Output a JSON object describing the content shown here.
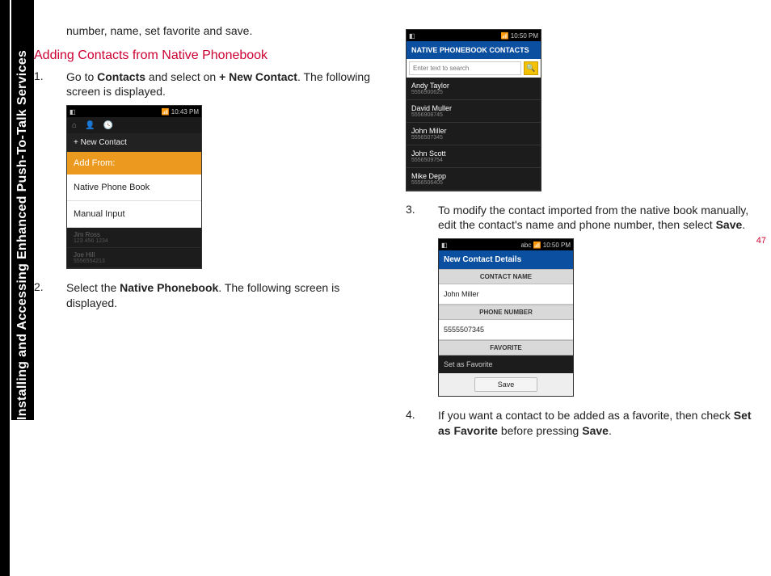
{
  "sidebar": {
    "label": "Installing and Accessing Enhanced Push-To-Talk Services"
  },
  "page_number": "47",
  "intro_line": "number, name, set favorite and save.",
  "section_title": "Adding Contacts from Native Phonebook",
  "steps": {
    "s1": {
      "num": "1.",
      "pre": "Go to ",
      "b1": "Contacts",
      "mid": " and select on ",
      "b2": "+ New Contact",
      "post": ". The following screen is displayed."
    },
    "s2": {
      "num": "2.",
      "pre": "Select the ",
      "b1": "Native Phonebook",
      "post": ". The following screen is displayed."
    },
    "s3": {
      "num": "3.",
      "text": "To modify the contact imported from the native book manually, edit the contact's name and phone number, then select ",
      "b1": "Save",
      "post": "."
    },
    "s4": {
      "num": "4.",
      "pre": "If you want a contact to be added as a favorite, then check ",
      "b1": "Set as Favorite",
      "mid": " before pressing ",
      "b2": "Save",
      "post": "."
    }
  },
  "phone1": {
    "time": "10:43 PM",
    "new_contact": "+ New Contact",
    "add_from": "Add From:",
    "opt1": "Native Phone Book",
    "opt2": "Manual Input",
    "dim1_name": "Jim Ross",
    "dim1_num": "123 456 1234",
    "dim2_name": "Joe Hill",
    "dim2_num": "5556554213"
  },
  "phone2": {
    "time": "10:50 PM",
    "header": "NATIVE PHONEBOOK CONTACTS",
    "placeholder": "Enter text to search",
    "contacts": [
      {
        "name": "Andy Taylor",
        "num": "5556900625"
      },
      {
        "name": "David Muller",
        "num": "5556908745"
      },
      {
        "name": "John Miller",
        "num": "5556507345"
      },
      {
        "name": "John Scott",
        "num": "5556509754"
      },
      {
        "name": "Mike Depp",
        "num": "5556506405"
      }
    ]
  },
  "phone3": {
    "time": "10:50 PM",
    "header": "New Contact Details",
    "label_name": "CONTACT NAME",
    "name_val": "John Miller",
    "label_phone": "PHONE NUMBER",
    "phone_val": "5555507345",
    "label_fav": "FAVORITE",
    "fav_text": "Set as Favorite",
    "save": "Save"
  }
}
